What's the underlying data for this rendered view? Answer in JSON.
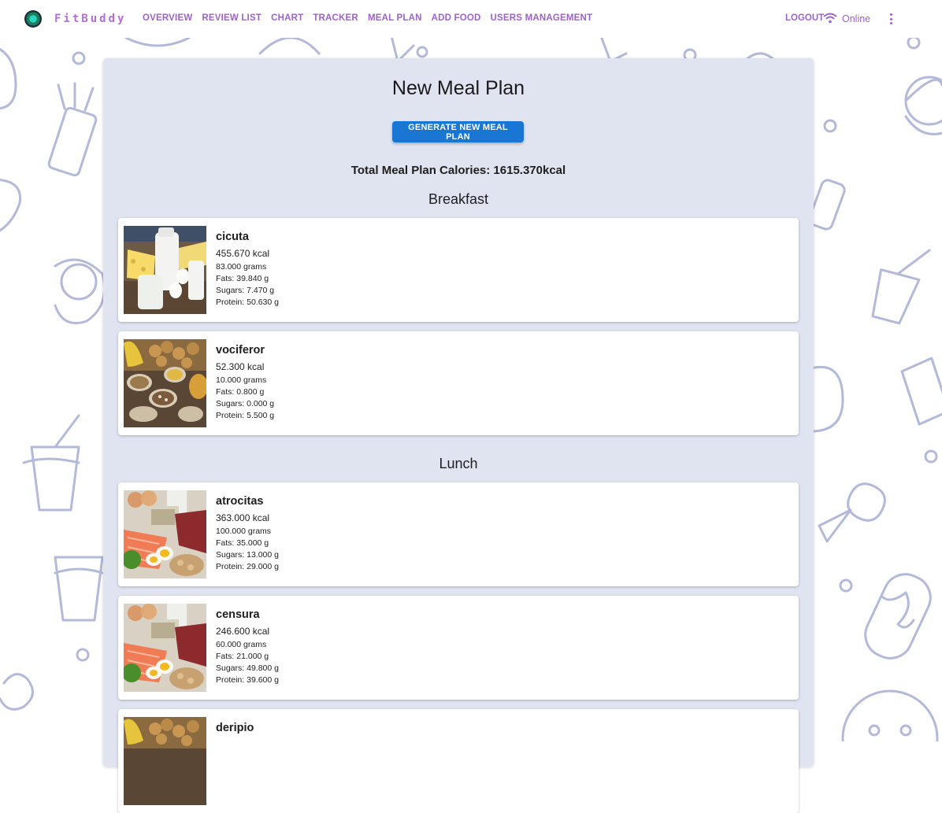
{
  "app": {
    "brand": "FitBuddy",
    "nav": [
      "OVERVIEW",
      "REVIEW LIST",
      "CHART",
      "TRACKER",
      "MEAL PLAN",
      "ADD FOOD",
      "USERS MANAGEMENT"
    ],
    "logout_label": "LOGOUT",
    "status_label": "Online",
    "accent_color": "#9c63c8",
    "icons": {
      "logo": "logo-icon",
      "wifi": "wifi-icon",
      "menu": "more-vert-icon"
    }
  },
  "page": {
    "title": "New Meal Plan",
    "generate_button": "GENERATE NEW MEAL PLAN",
    "total_calories": "Total Meal Plan Calories: 1615.370kcal"
  },
  "sections": [
    {
      "title": "Breakfast",
      "items": [
        {
          "name": "cicuta",
          "kcal": "455.670 kcal",
          "grams": "83.000 grams",
          "fats": "Fats: 39.840 g",
          "sugars": "Sugars: 7.470 g",
          "protein": "Protein: 50.630 g",
          "image": "dairy-photo"
        },
        {
          "name": "vociferor",
          "kcal": "52.300 kcal",
          "grams": "10.000 grams",
          "fats": "Fats: 0.800 g",
          "sugars": "Sugars: 0.000 g",
          "protein": "Protein: 5.500 g",
          "image": "grains-potatoes-photo"
        }
      ]
    },
    {
      "title": "Lunch",
      "items": [
        {
          "name": "atrocitas",
          "kcal": "363.000 kcal",
          "grams": "100.000 grams",
          "fats": "Fats: 35.000 g",
          "sugars": "Sugars: 13.000 g",
          "protein": "Protein: 29.000 g",
          "image": "protein-foods-photo"
        },
        {
          "name": "censura",
          "kcal": "246.600 kcal",
          "grams": "60.000 grams",
          "fats": "Fats: 21.000 g",
          "sugars": "Sugars: 49.800 g",
          "protein": "Protein: 39.600 g",
          "image": "protein-foods-photo"
        },
        {
          "name": "deripio",
          "kcal": "",
          "grams": "",
          "fats": "",
          "sugars": "",
          "protein": "",
          "image": "grains-potatoes-photo"
        }
      ]
    }
  ]
}
